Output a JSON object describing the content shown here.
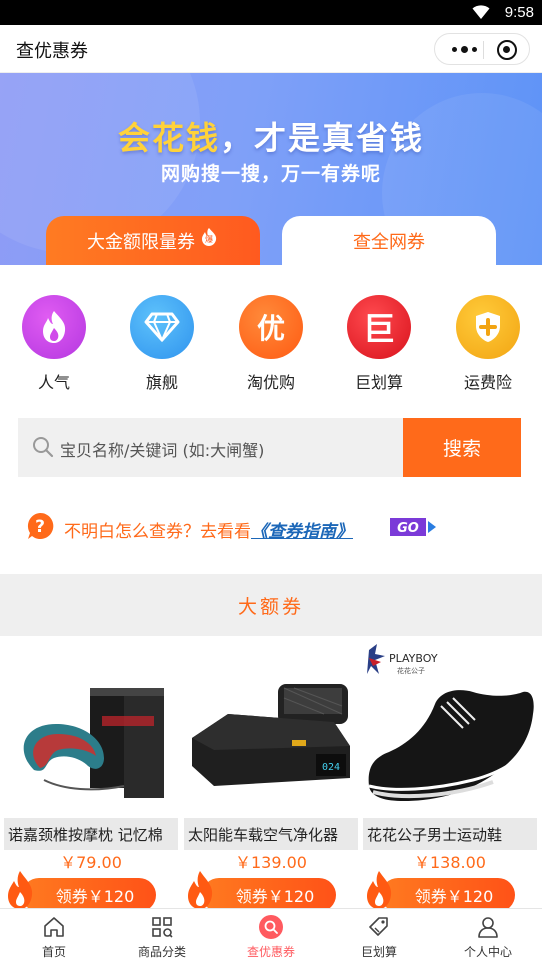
{
  "status_bar": {
    "time": "9:58"
  },
  "nav": {
    "title": "查优惠券"
  },
  "banner": {
    "title_highlight": "会花钱",
    "title_rest": "，才是真省钱",
    "subtitle": "网购搜一搜，万一有券呢",
    "tab_big": "大金额限量券",
    "tab_big_badge": "爆",
    "tab_all": "查全网券"
  },
  "categories": [
    {
      "label": "人气",
      "icon": "flame-icon",
      "color": "#c84be8"
    },
    {
      "label": "旗舰",
      "icon": "diamond-icon",
      "color": "#3aa8f2"
    },
    {
      "label": "淘优购",
      "icon": "you-icon",
      "color": "#ff6a1a",
      "glyph": "优"
    },
    {
      "label": "巨划算",
      "icon": "ju-icon",
      "color": "#e8202a",
      "glyph": "巨"
    },
    {
      "label": "运费险",
      "icon": "shield-plus-icon",
      "color": "#f3b21a"
    }
  ],
  "search": {
    "placeholder": "宝贝名称/关键词 (如:大闸蟹)",
    "button": "搜索"
  },
  "guide": {
    "text": "不明白怎么查券？去看看",
    "link": "《查券指南》",
    "go": "GO"
  },
  "section": {
    "title": "大额券"
  },
  "products": [
    {
      "name": "诺嘉颈椎按摩枕 记忆棉",
      "price": "￥79.00",
      "coupon": "领券￥120"
    },
    {
      "name": "太阳能车载空气净化器",
      "price": "￥139.00",
      "coupon": "领券￥120"
    },
    {
      "name": "花花公子男士运动鞋",
      "price": "￥138.00",
      "coupon": "领券￥120",
      "brand": "PLAYBOY",
      "brand_sub": "花花公子"
    }
  ],
  "tabbar": [
    {
      "label": "首页",
      "icon": "home-icon"
    },
    {
      "label": "商品分类",
      "icon": "grid-icon"
    },
    {
      "label": "查优惠券",
      "icon": "search-icon",
      "active": true
    },
    {
      "label": "巨划算",
      "icon": "tag-icon"
    },
    {
      "label": "个人中心",
      "icon": "user-icon"
    }
  ],
  "colors": {
    "accent": "#ff6a1a",
    "tab_active": "#ff5a5f",
    "link": "#1c67b8"
  }
}
